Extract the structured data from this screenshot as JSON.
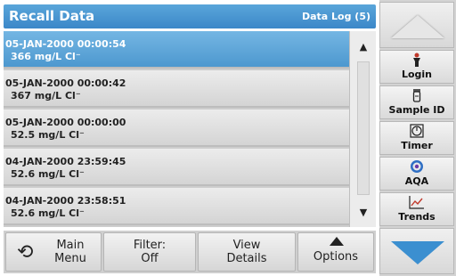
{
  "header": {
    "title": "Recall Data",
    "subtitle": "Data Log (5)"
  },
  "list": {
    "items": [
      {
        "datetime": "05-JAN-2000  00:00:54",
        "value": "366  mg/L  Cl⁻",
        "selected": true
      },
      {
        "datetime": "05-JAN-2000  00:00:42",
        "value": "367  mg/L  Cl⁻",
        "selected": false
      },
      {
        "datetime": "05-JAN-2000  00:00:00",
        "value": "52.5  mg/L  Cl⁻",
        "selected": false
      },
      {
        "datetime": "04-JAN-2000  23:59:45",
        "value": "52.6  mg/L  Cl⁻",
        "selected": false
      },
      {
        "datetime": "04-JAN-2000  23:58:51",
        "value": "52.6  mg/L  Cl⁻",
        "selected": false
      }
    ]
  },
  "bottom": {
    "main_menu": {
      "line1": "Main",
      "line2": "Menu"
    },
    "filter": {
      "line1": "Filter:",
      "line2": "Off"
    },
    "view_details": {
      "line1": "View",
      "line2": "Details"
    },
    "options": {
      "label": "Options"
    }
  },
  "side": {
    "items": [
      {
        "label": "Login",
        "icon": "person-icon"
      },
      {
        "label": "Sample ID",
        "icon": "sample-vial-icon"
      },
      {
        "label": "Timer",
        "icon": "timer-icon"
      },
      {
        "label": "AQA",
        "icon": "aqa-icon"
      },
      {
        "label": "Trends",
        "icon": "trends-chart-icon"
      }
    ]
  },
  "colors": {
    "accent": "#4d98cf",
    "title_bar": "#3b87c8",
    "nav_down": "#3b8fd0"
  }
}
